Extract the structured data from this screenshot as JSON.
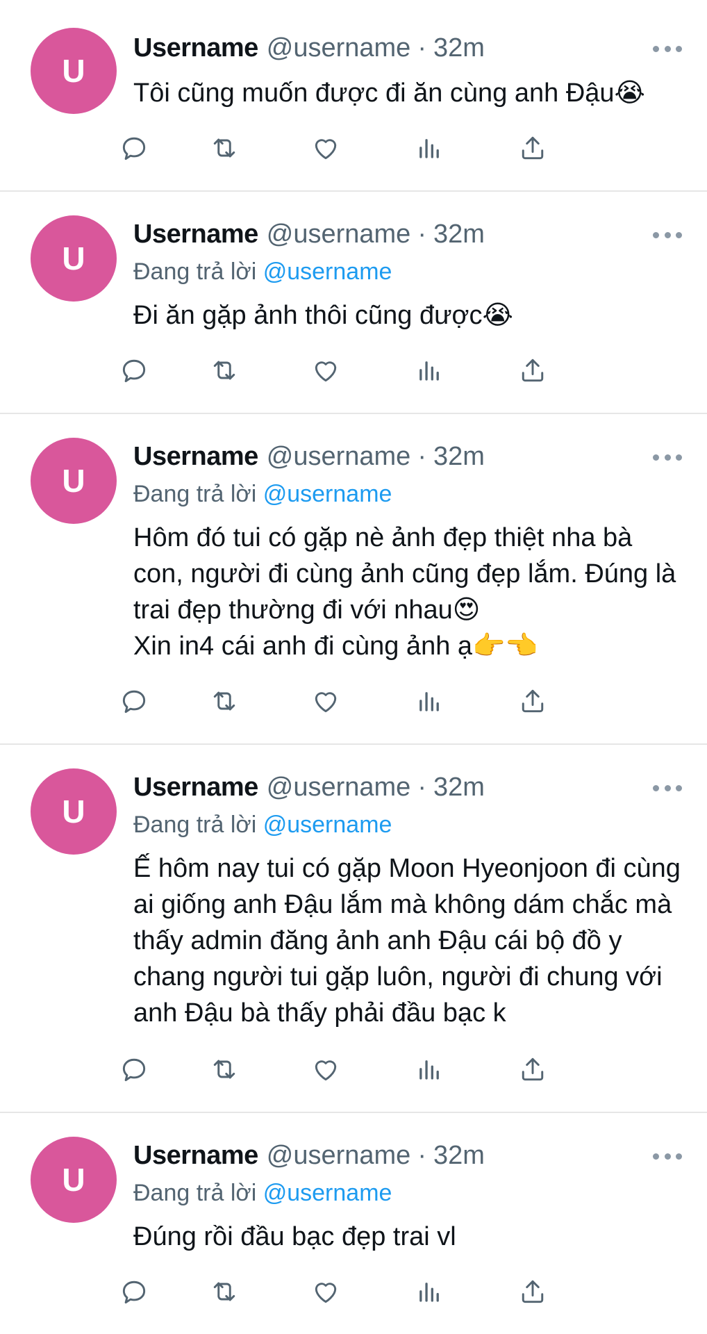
{
  "tweets": [
    {
      "avatar_letter": "U",
      "name": "Username",
      "handle": "@username",
      "separator": "·",
      "time": "32m",
      "replying_prefix": "",
      "replying_to": "",
      "text": "Tôi cũng muốn được đi ăn cùng anh Đậu😭"
    },
    {
      "avatar_letter": "U",
      "name": "Username",
      "handle": "@username",
      "separator": "·",
      "time": "32m",
      "replying_prefix": "Đang trả lời",
      "replying_to": "@username",
      "text": "Đi ăn gặp ảnh thôi cũng được😭"
    },
    {
      "avatar_letter": "U",
      "name": "Username",
      "handle": "@username",
      "separator": "·",
      "time": "32m",
      "replying_prefix": "Đang trả lời",
      "replying_to": "@username",
      "text": "Hôm đó tui có gặp nè ảnh đẹp thiệt nha bà con, người đi cùng ảnh cũng đẹp lắm. Đúng là trai đẹp thường đi với nhau😍\nXin in4 cái anh đi cùng ảnh ạ👉👈"
    },
    {
      "avatar_letter": "U",
      "name": "Username",
      "handle": "@username",
      "separator": "·",
      "time": "32m",
      "replying_prefix": "Đang trả lời",
      "replying_to": "@username",
      "text": "Ế hôm nay tui có gặp Moon Hyeonjoon đi cùng ai giống anh Đậu lắm mà không dám chắc mà thấy admin đăng ảnh anh Đậu cái bộ đồ y chang người tui gặp luôn, người đi chung với anh Đậu bà thấy phải đầu bạc k"
    },
    {
      "avatar_letter": "U",
      "name": "Username",
      "handle": "@username",
      "separator": "·",
      "time": "32m",
      "replying_prefix": "Đang trả lời",
      "replying_to": "@username",
      "text": "Đúng rồi đầu bạc đẹp trai vl"
    }
  ],
  "action_icons": [
    "reply-icon",
    "retweet-icon",
    "like-icon",
    "views-icon",
    "share-icon"
  ],
  "colors": {
    "avatar": "#d9579b",
    "link": "#1d9bf0",
    "secondary_text": "#536471",
    "icon": "#536471",
    "divider": "#e6e6e6"
  }
}
